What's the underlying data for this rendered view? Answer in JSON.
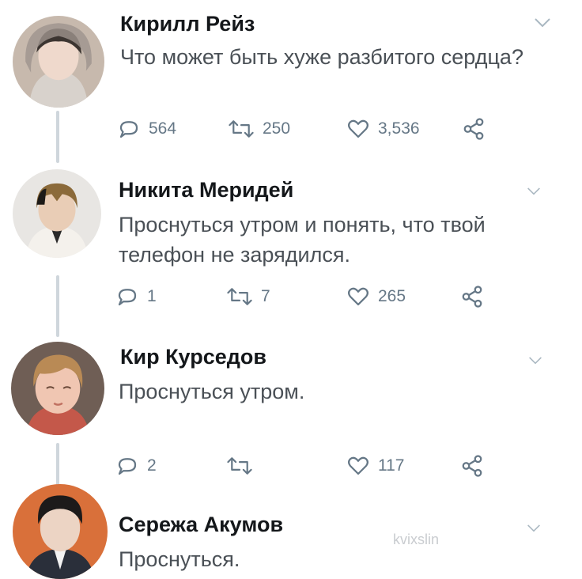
{
  "watermark": "kvixslin",
  "tweets": [
    {
      "author": "Кирилл Рейз",
      "text": "Что может быть хуже разбитого сердца?",
      "replies": "564",
      "retweets": "250",
      "likes": "3,536",
      "avatar_colors": {
        "bg": "#c7b9ad",
        "hair": "#3c3531",
        "skin": "#efd9cc",
        "clothes": "#d8d2cc"
      }
    },
    {
      "author": "Никита Меридей",
      "text": "Проснуться утром и понять, что твой телефон не зарядился.",
      "replies": "1",
      "retweets": "7",
      "likes": "265",
      "avatar_colors": {
        "bg": "#e8e6e3",
        "hair": "#8b6a3a",
        "skin": "#e9cdb6",
        "clothes": "#f4f1ec"
      }
    },
    {
      "author": "Кир Курседов",
      "text": "Проснуться утром.",
      "replies": "2",
      "retweets": "",
      "likes": "117",
      "avatar_colors": {
        "bg": "#6f5e55",
        "hair": "#b98a55",
        "skin": "#f0c6b2",
        "clothes": "#c4584a"
      }
    },
    {
      "author": "Сережа Акумов",
      "text": "Проснуться.",
      "replies": "",
      "retweets": "",
      "likes": "",
      "avatar_colors": {
        "bg": "#d9703a",
        "hair": "#1c1a1a",
        "skin": "#ecd4c4",
        "clothes": "#2a2f3a"
      }
    }
  ]
}
